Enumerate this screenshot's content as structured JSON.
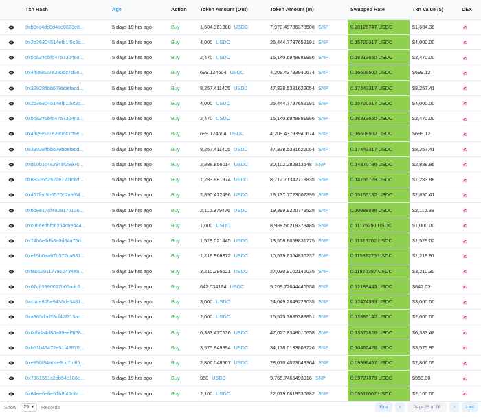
{
  "header": {
    "txn_hash": "Txn Hash",
    "age": "Age",
    "action": "Action",
    "amount_out": "Token Amount (Out)",
    "amount_in": "Token Amount (In)",
    "rate": "Swapped Rate",
    "value": "Txn Value ($)",
    "dex": "DEX"
  },
  "colors": {
    "link": "#3498db",
    "buy": "#28a745",
    "rate_bg": "#8fd14f"
  },
  "rows": [
    {
      "hash": "0xb9cc4dc8d4dc0623e8...",
      "age": "5 days 19 hrs ago",
      "action": "Buy",
      "out_amt": "1,604.361388",
      "out_tok": "USDC",
      "in_amt": "7,970.49786378506",
      "in_tok": "SNP",
      "rate": "0.20128747 USDC",
      "value": "$1,604.36"
    },
    {
      "hash": "0x2b36304514efb1f0c3c...",
      "age": "5 days 19 hrs ago",
      "action": "Buy",
      "out_amt": "4,000",
      "out_tok": "USDC",
      "in_amt": "25,444.7787652191",
      "in_tok": "SNP",
      "rate": "0.15720317 USDC",
      "value": "$4,000.00"
    },
    {
      "hash": "0x56a346bf647573248a...",
      "age": "5 days 19 hrs ago",
      "action": "Buy",
      "out_amt": "2,470",
      "out_tok": "USDC",
      "in_amt": "15,140.6948881986",
      "in_tok": "SNP",
      "rate": "0.16313650 USDC",
      "value": "$2,470.00"
    },
    {
      "hash": "0x4f6e8527e280dc7d9e...",
      "age": "5 days 19 hrs ago",
      "action": "Buy",
      "out_amt": "699.124604",
      "out_tok": "USDC",
      "in_amt": "4,209.43793940674",
      "in_tok": "SNP",
      "rate": "0.16608502 USDC",
      "value": "$699.12"
    },
    {
      "hash": "0x33928ffbb579bbefacd...",
      "age": "5 days 19 hrs ago",
      "action": "Buy",
      "out_amt": "8,257.411405",
      "out_tok": "USDC",
      "in_amt": "47,338.5381622054",
      "in_tok": "SNP",
      "rate": "0.17443317 USDC",
      "value": "$8,257.41"
    },
    {
      "hash": "0x2b36304514efb1f0c3c...",
      "age": "5 days 19 hrs ago",
      "action": "Buy",
      "out_amt": "4,000",
      "out_tok": "USDC",
      "in_amt": "25,444.7787652191",
      "in_tok": "SNP",
      "rate": "0.15720317 USDC",
      "value": "$4,000.00"
    },
    {
      "hash": "0x56a346bf647573248a...",
      "age": "5 days 19 hrs ago",
      "action": "Buy",
      "out_amt": "2,470",
      "out_tok": "USDC",
      "in_amt": "15,140.6948881986",
      "in_tok": "SNP",
      "rate": "0.16313650 USDC",
      "value": "$2,470.00"
    },
    {
      "hash": "0x4f6e8527e280dc7d9e...",
      "age": "5 days 19 hrs ago",
      "action": "Buy",
      "out_amt": "699.124604",
      "out_tok": "USDC",
      "in_amt": "4,209.43793940674",
      "in_tok": "SNP",
      "rate": "0.16608502 USDC",
      "value": "$699.12"
    },
    {
      "hash": "0x33928ffbb579bbefacd...",
      "age": "5 days 19 hrs ago",
      "action": "Buy",
      "out_amt": "8,257.411405",
      "out_tok": "USDC",
      "in_amt": "47,338.5381622054",
      "in_tok": "SNP",
      "rate": "0.17443317 USDC",
      "value": "$8,257.41"
    },
    {
      "hash": "0xd10b1c462948f29976...",
      "age": "5 days 19 hrs ago",
      "action": "Buy",
      "out_amt": "2,888.856014",
      "out_tok": "USDC",
      "in_amt": "20,102.282913548",
      "in_tok": "SNP",
      "rate": "0.14370786 USDC",
      "value": "$2,888.86"
    },
    {
      "hash": "0x83326d2523e123fc8d...",
      "age": "5 days 19 hrs ago",
      "action": "Buy",
      "out_amt": "1,283.881874",
      "out_tok": "USDC",
      "in_amt": "8,712.71342713835",
      "in_tok": "SNP",
      "rate": "0.14735729 USDC",
      "value": "$1,283.88"
    },
    {
      "hash": "0x457fec5b5570c2aaf64...",
      "age": "5 days 19 hrs ago",
      "action": "Buy",
      "out_amt": "2,890.412496",
      "out_tok": "USDC",
      "in_amt": "19,137.7723007395",
      "in_tok": "SNP",
      "rate": "0.15103182 USDC",
      "value": "$2,890.41"
    },
    {
      "hash": "0xbb8e17af4829170136...",
      "age": "5 days 19 hrs ago",
      "action": "Buy",
      "out_amt": "2,112.379476",
      "out_tok": "USDC",
      "in_amt": "19,399.9220773528",
      "in_tok": "SNP",
      "rate": "0.10888598 USDC",
      "value": "$2,112.38"
    },
    {
      "hash": "0xc066ed5fc6254cbe444...",
      "age": "5 days 19 hrs ago",
      "action": "Buy",
      "out_amt": "1,000",
      "out_tok": "USDC",
      "in_amt": "8,988.56219373485",
      "in_tok": "SNP",
      "rate": "0.11125250 USDC",
      "value": "$1,000.00"
    },
    {
      "hash": "0x24b6e1db8a0d84a75d...",
      "age": "5 days 19 hrs ago",
      "action": "Buy",
      "out_amt": "1,529.021445",
      "out_tok": "USDC",
      "in_amt": "13,508.8058831775",
      "in_tok": "SNP",
      "rate": "0.11318702 USDC",
      "value": "$1,529.02"
    },
    {
      "hash": "0xe15b0aa67b572ca031...",
      "age": "5 days 19 hrs ago",
      "action": "Buy",
      "out_amt": "1,219.966872",
      "out_tok": "USDC",
      "in_amt": "10,579.6354836237",
      "in_tok": "SNP",
      "rate": "0.11531275 USDC",
      "value": "$1,219.97"
    },
    {
      "hash": "0xfa06291177812434e8...",
      "age": "5 days 19 hrs ago",
      "action": "Buy",
      "out_amt": "3,210.295621",
      "out_tok": "USDC",
      "in_amt": "27,030.9102146035",
      "in_tok": "SNP",
      "rate": "0.11876387 USDC",
      "value": "$3,210.30"
    },
    {
      "hash": "0x07cb5990087b05adc3...",
      "age": "5 days 19 hrs ago",
      "action": "Buy",
      "out_amt": "642.034124",
      "out_tok": "USDC",
      "in_amt": "5,269.72644446558",
      "in_tok": "SNP",
      "rate": "0.12183443 USDC",
      "value": "$642.03"
    },
    {
      "hash": "0xcbde805e9436de3481...",
      "age": "5 days 19 hrs ago",
      "action": "Buy",
      "out_amt": "3,000",
      "out_tok": "USDC",
      "in_amt": "24,049.2849229035",
      "in_tok": "SNP",
      "rate": "0.12474383 USDC",
      "value": "$3,000.00"
    },
    {
      "hash": "0xa965ddd28cf47f715ac...",
      "age": "5 days 19 hrs ago",
      "action": "Buy",
      "out_amt": "2,000",
      "out_tok": "USDC",
      "in_amt": "15,525.3685389851",
      "in_tok": "SNP",
      "rate": "0.12882142 USDC",
      "value": "$2,000.00"
    },
    {
      "hash": "0x0d5da4d80a09eef3f08...",
      "age": "5 days 19 hrs ago",
      "action": "Buy",
      "out_amt": "6,383.477536",
      "out_tok": "USDC",
      "in_amt": "47,027.8348010658",
      "in_tok": "SNP",
      "rate": "0.13573826 USDC",
      "value": "$6,383.48"
    },
    {
      "hash": "0xb51b43472e51f43670...",
      "age": "5 days 19 hrs ago",
      "action": "Buy",
      "out_amt": "3,575.849894",
      "out_tok": "USDC",
      "in_amt": "34,178.0133809726",
      "in_tok": "SNP",
      "rate": "0.10462426 USDC",
      "value": "$3,575.85"
    },
    {
      "hash": "0xe950f94abce9cc7b9f6...",
      "age": "5 days 19 hrs ago",
      "action": "Buy",
      "out_amt": "2,806.048567",
      "out_tok": "USDC",
      "in_amt": "28,070.4023049364",
      "in_tok": "SNP",
      "rate": "0.09996467 USDC",
      "value": "$2,806.05"
    },
    {
      "hash": "0x7361551c2db54c106c...",
      "age": "5 days 19 hrs ago",
      "action": "Buy",
      "out_amt": "950",
      "out_tok": "USDC",
      "in_amt": "9,765.7465493916",
      "in_tok": "SNP",
      "rate": "0.09727879 USDC",
      "value": "$950.00"
    },
    {
      "hash": "0x84ee6e6e51b8f43c8c...",
      "age": "5 days 19 hrs ago",
      "action": "Buy",
      "out_amt": "2,100",
      "out_tok": "USDC",
      "in_amt": "22,079.6819530882",
      "in_tok": "SNP",
      "rate": "0.09511007 USDC",
      "value": "$2,100.00"
    }
  ],
  "footer": {
    "show_label": "Show",
    "page_size": "25",
    "records_label": "Records",
    "first": "First",
    "prev": "‹",
    "page_info": "Page 75 of 76",
    "next": "›",
    "last": "Last"
  }
}
